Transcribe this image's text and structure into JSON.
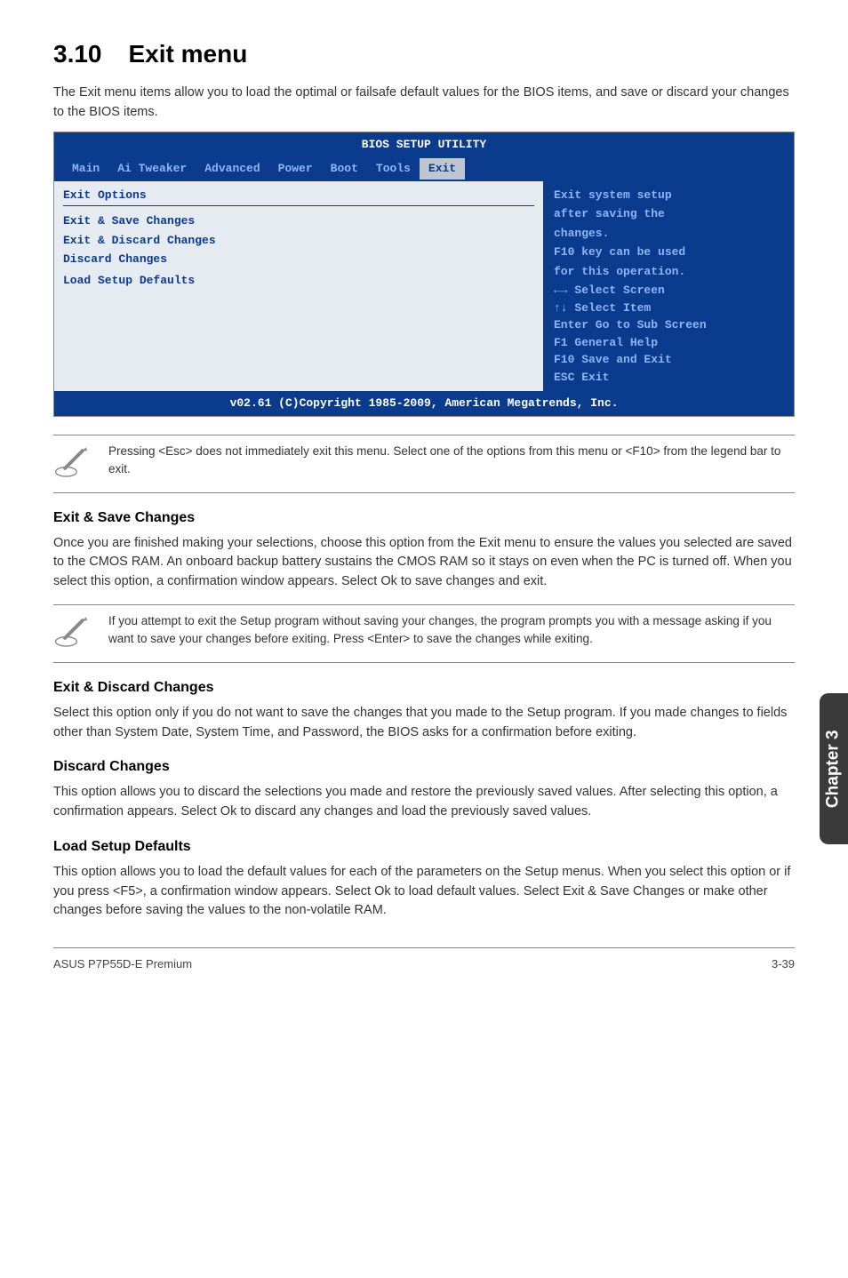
{
  "section": {
    "number": "3.10",
    "title": "Exit menu",
    "intro": "The Exit menu items allow you to load the optimal or failsafe default values for the BIOS items, and save or discard your changes to the BIOS items."
  },
  "bios": {
    "title": "BIOS SETUP UTILITY",
    "menubar": [
      "Main",
      "Ai Tweaker",
      "Advanced",
      "Power",
      "Boot",
      "Tools",
      "Exit"
    ],
    "active_tab": "Exit",
    "left": {
      "header": "Exit Options",
      "options": [
        "Exit & Save Changes",
        "Exit & Discard Changes",
        "Discard Changes",
        "",
        "Load Setup Defaults"
      ]
    },
    "right": {
      "help_lines": [
        "Exit system setup",
        "after saving the",
        "changes.",
        "",
        "F10 key can be used",
        "for this operation."
      ],
      "nav_lines": [
        "←→    Select Screen",
        "↑↓    Select Item",
        "Enter Go to Sub Screen",
        "F1    General Help",
        "F10   Save and Exit",
        "ESC   Exit"
      ]
    },
    "footer": "v02.61 (C)Copyright 1985-2009, American Megatrends, Inc."
  },
  "note1": "Pressing <Esc> does not immediately exit this menu. Select one of the options from this menu or <F10> from the legend bar to exit.",
  "s1": {
    "title": "Exit & Save Changes",
    "body": "Once you are finished making your selections, choose this option from the Exit menu to ensure the values you selected are saved to the CMOS RAM. An onboard backup battery sustains the CMOS RAM so it stays on even when the PC is turned off. When you select this option, a confirmation window appears. Select Ok to save changes and exit."
  },
  "note2": "If you attempt to exit the Setup program without saving your changes, the program prompts you with a message asking if you want to save your changes before exiting. Press <Enter> to save the changes while exiting.",
  "s2": {
    "title": "Exit & Discard Changes",
    "body": "Select this option only if you do not want to save the changes that you  made to the Setup program. If you made changes to fields other than System Date, System Time, and Password, the BIOS asks for a confirmation before exiting."
  },
  "s3": {
    "title": "Discard Changes",
    "body": "This option allows you to discard the selections you made and restore the previously saved values. After selecting this option, a confirmation appears. Select Ok to discard any changes and load the previously saved values."
  },
  "s4": {
    "title": "Load Setup Defaults",
    "body": "This option allows you to load the default values for each of the parameters on the Setup menus. When you select this option or if you press <F5>, a confirmation window appears. Select Ok to load default values. Select Exit & Save Changes or make other changes before saving the values to the non-volatile RAM."
  },
  "side_tab": "Chapter 3",
  "footer": {
    "left": "ASUS P7P55D-E Premium",
    "right": "3-39"
  }
}
